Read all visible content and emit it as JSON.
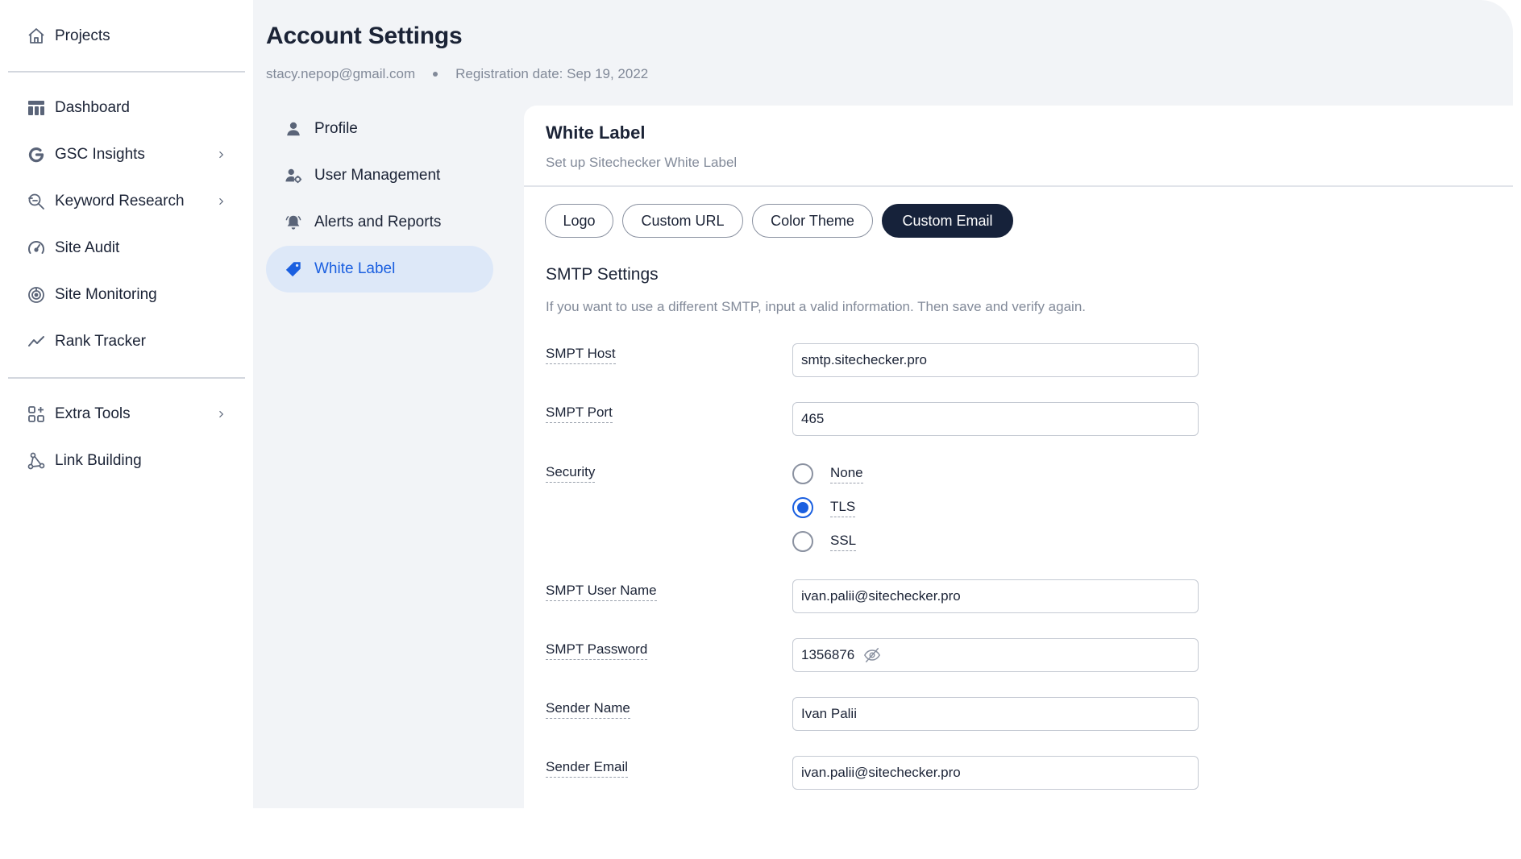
{
  "sidebar": {
    "items": [
      {
        "label": "Projects",
        "icon": "home-icon"
      },
      {
        "label": "Dashboard",
        "icon": "dashboard-icon"
      },
      {
        "label": "GSC Insights",
        "icon": "google-icon",
        "has_children": true
      },
      {
        "label": "Keyword Research",
        "icon": "keyword-search-icon",
        "has_children": true
      },
      {
        "label": "Site Audit",
        "icon": "gauge-icon"
      },
      {
        "label": "Site Monitoring",
        "icon": "radar-icon"
      },
      {
        "label": "Rank Tracker",
        "icon": "trend-icon"
      },
      {
        "label": "Extra Tools",
        "icon": "apps-plus-icon",
        "has_children": true
      },
      {
        "label": "Link Building",
        "icon": "link-nodes-icon"
      }
    ]
  },
  "header": {
    "title": "Account Settings",
    "email": "stacy.nepop@gmail.com",
    "registration": "Registration date: Sep 19, 2022"
  },
  "settings_menu": {
    "items": [
      {
        "label": "Profile",
        "icon": "user-icon"
      },
      {
        "label": "User Management",
        "icon": "user-gear-icon"
      },
      {
        "label": "Alerts and Reports",
        "icon": "bell-icon"
      },
      {
        "label": "White Label",
        "icon": "tag-icon",
        "active": true
      }
    ]
  },
  "card": {
    "title": "White Label",
    "subtitle": "Set up Sitechecker White Label",
    "tabs": [
      {
        "label": "Logo"
      },
      {
        "label": "Custom URL"
      },
      {
        "label": "Color Theme"
      },
      {
        "label": "Custom Email",
        "active": true
      }
    ],
    "smtp": {
      "title": "SMTP Settings",
      "help": "If you want to use a different SMTP, input a valid information. Then save and verify again.",
      "host_label": "SMPT Host",
      "host_value": "smtp.sitechecker.pro",
      "port_label": "SMPT Port",
      "port_value": "465",
      "security_label": "Security",
      "security_options": [
        "None",
        "TLS",
        "SSL"
      ],
      "security_selected": "TLS",
      "username_label": "SMPT User Name",
      "username_value": "ivan.palii@sitechecker.pro",
      "password_label": "SMPT Password",
      "password_value": "1356876",
      "sender_name_label": "Sender Name",
      "sender_name_value": "Ivan Palii",
      "sender_email_label": "Sender Email",
      "sender_email_value": "ivan.palii@sitechecker.pro"
    }
  },
  "colors": {
    "accent": "#1a5fe0",
    "active_tab_bg": "#16223a",
    "active_menu_bg": "#dde8f8",
    "canvas_bg": "#f2f4f7",
    "text": "#1b2336",
    "muted": "#828a99"
  }
}
